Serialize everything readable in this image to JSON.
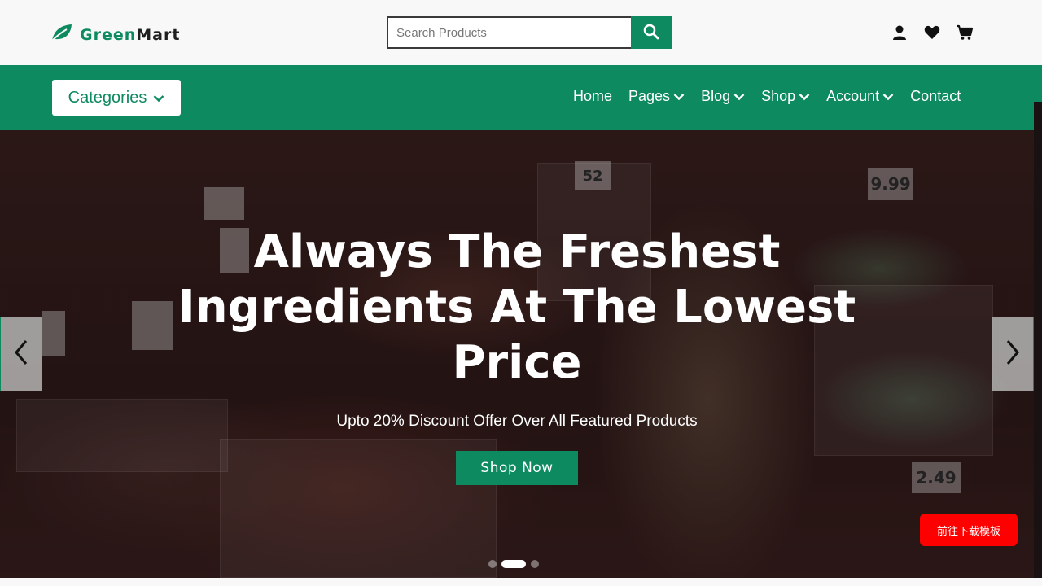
{
  "brand": {
    "name_part1": "Green",
    "name_part2": "Mart",
    "accent_color": "#0d8a5f"
  },
  "search": {
    "placeholder": "Search Products",
    "icon": "search-icon"
  },
  "header_icons": [
    "user-icon",
    "heart-icon",
    "cart-icon"
  ],
  "categories_label": "Categories",
  "nav": [
    {
      "label": "Home",
      "dropdown": false
    },
    {
      "label": "Pages",
      "dropdown": true
    },
    {
      "label": "Blog",
      "dropdown": true
    },
    {
      "label": "Shop",
      "dropdown": true
    },
    {
      "label": "Account",
      "dropdown": true
    },
    {
      "label": "Contact",
      "dropdown": false
    }
  ],
  "hero": {
    "title_line1": "Always The Freshest",
    "title_line2": "Ingredients At The Lowest",
    "title_line3": "Price",
    "subtitle": "Upto 20% Discount Offer Over All Featured Products",
    "cta_label": "Shop Now",
    "slides_total": 3,
    "active_slide": 2,
    "signs": [
      "9.99",
      "52",
      "2.49"
    ]
  },
  "floating_button": {
    "label": "前往下载模板",
    "color": "#ff0000"
  }
}
